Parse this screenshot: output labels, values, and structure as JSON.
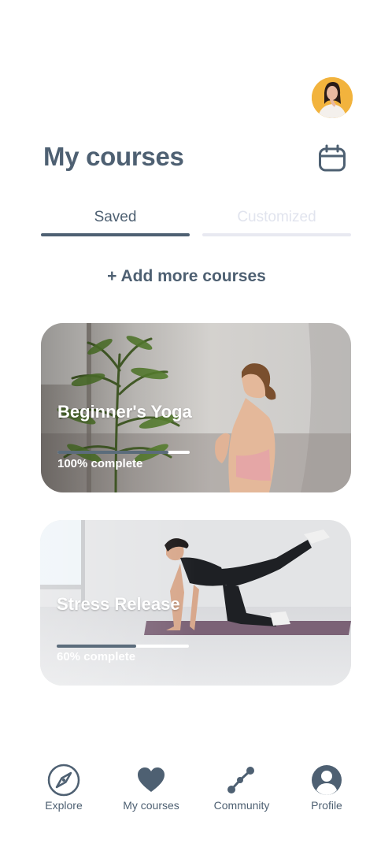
{
  "header": {
    "title": "My courses"
  },
  "tabs": [
    {
      "label": "Saved",
      "active": true
    },
    {
      "label": "Customized",
      "active": false
    }
  ],
  "add_more_label": "+ Add more courses",
  "courses": [
    {
      "title": "Beginner's Yoga",
      "progress_text": "100% complete",
      "progress_fill_fraction": 0.84
    },
    {
      "title": "Stress Release",
      "progress_text": "60% complete",
      "progress_fill_fraction": 0.6
    }
  ],
  "nav": [
    {
      "label": "Explore",
      "icon": "compass-icon"
    },
    {
      "label": "My courses",
      "icon": "heart-icon"
    },
    {
      "label": "Community",
      "icon": "network-icon"
    },
    {
      "label": "Profile",
      "icon": "user-icon"
    }
  ],
  "colors": {
    "primary": "#4e6072",
    "inactive_tab": "#e1e4ee",
    "avatar_bg": "#f2b33d"
  }
}
